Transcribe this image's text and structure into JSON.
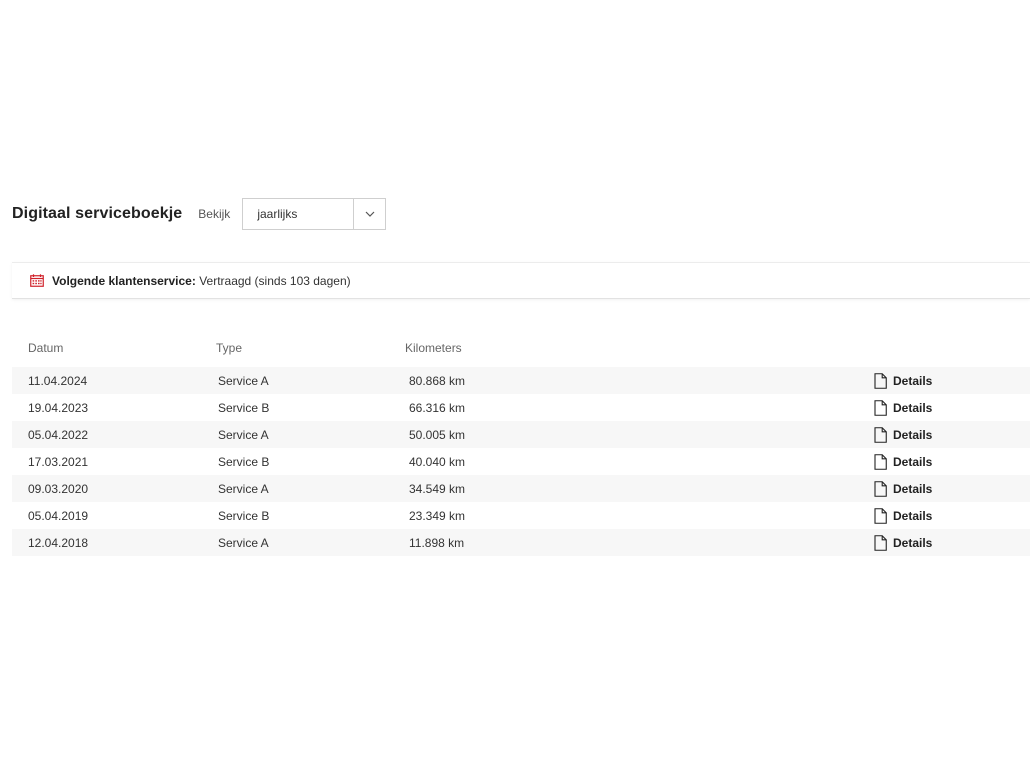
{
  "header": {
    "title": "Digitaal serviceboekje",
    "view_label": "Bekijk",
    "view_select": {
      "selected": "jaarlijks"
    }
  },
  "notice": {
    "icon": "calendar-icon",
    "label": "Volgende klantenservice:",
    "value": "Vertraagd (sinds 103 dagen)",
    "accent_color": "#d0212a"
  },
  "table": {
    "columns": {
      "date": "Datum",
      "type": "Type",
      "km": "Kilometers"
    },
    "details_label": "Details",
    "rows": [
      {
        "date": "11.04.2024",
        "type": "Service A",
        "km": "80.868 km"
      },
      {
        "date": "19.04.2023",
        "type": "Service B",
        "km": "66.316 km"
      },
      {
        "date": "05.04.2022",
        "type": "Service A",
        "km": "50.005 km"
      },
      {
        "date": "17.03.2021",
        "type": "Service B",
        "km": "40.040 km"
      },
      {
        "date": "09.03.2020",
        "type": "Service A",
        "km": "34.549 km"
      },
      {
        "date": "05.04.2019",
        "type": "Service B",
        "km": "23.349 km"
      },
      {
        "date": "12.04.2018",
        "type": "Service A",
        "km": "11.898 km"
      }
    ]
  }
}
